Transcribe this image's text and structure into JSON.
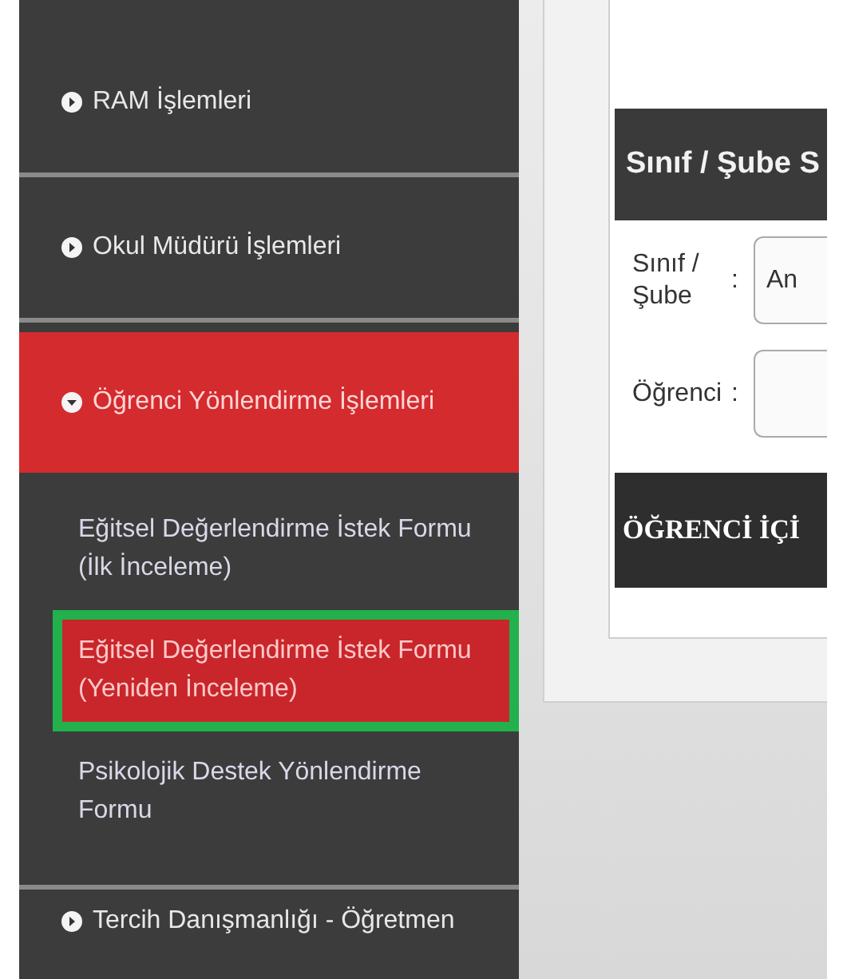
{
  "sidebar": {
    "items": [
      {
        "label": "RAM İşlemleri",
        "expanded": false
      },
      {
        "label": "Okul Müdürü İşlemleri",
        "expanded": false
      },
      {
        "label": "Öğrenci Yönlendirme İşlemleri",
        "expanded": true,
        "children": [
          {
            "label": "Eğitsel Değerlendirme İstek Formu (İlk İnceleme)",
            "selected": false,
            "highlighted": false
          },
          {
            "label": "Eğitsel Değerlendirme İstek Formu (Yeniden İnceleme)",
            "selected": true,
            "highlighted": true
          },
          {
            "label": "Psikolojik Destek Yönlendirme Formu",
            "selected": false,
            "highlighted": false
          }
        ]
      },
      {
        "label": "Tercih Danışmanlığı - Öğretmen",
        "expanded": false
      }
    ]
  },
  "panel": {
    "title": "Sınıf / Şube S",
    "fields": [
      {
        "label": "Sınıf / Şube",
        "separator": ":",
        "value": "An"
      },
      {
        "label": "Öğrenci",
        "separator": ":"
      }
    ],
    "section_title": "ÖĞRENCİ İÇİ"
  }
}
